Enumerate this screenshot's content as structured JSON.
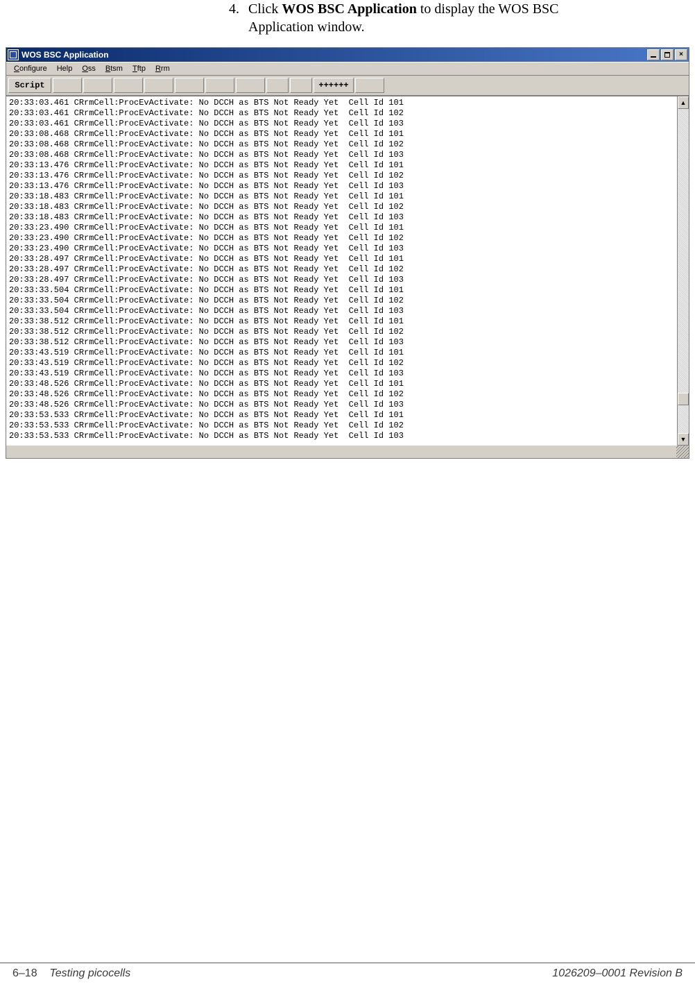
{
  "instruction": {
    "number": "4.",
    "text_before": "Click ",
    "bold": "WOS BSC Application",
    "text_after": " to display the WOS BSC Application window."
  },
  "window": {
    "title": "WOS BSC Application",
    "menu": {
      "configure_pre": "C",
      "configure_post": "onfigure",
      "help": "Help",
      "oss_pre": "O",
      "oss_post": "ss",
      "btsm_pre": "B",
      "btsm_post": "tsm",
      "tftp_pre": "T",
      "tftp_post": "ftp",
      "rrm_pre": "R",
      "rrm_post": "rm"
    },
    "toolbar": {
      "script": "Script",
      "plus": "++++++"
    }
  },
  "log_message": "CRrmCell:ProcEvActivate: No DCCH as BTS Not Ready Yet",
  "log_cell_prefix": "Cell Id",
  "log_rows": [
    {
      "time": "20:33:03.461",
      "cell": "101"
    },
    {
      "time": "20:33:03.461",
      "cell": "102"
    },
    {
      "time": "20:33:03.461",
      "cell": "103"
    },
    {
      "time": "20:33:08.468",
      "cell": "101"
    },
    {
      "time": "20:33:08.468",
      "cell": "102"
    },
    {
      "time": "20:33:08.468",
      "cell": "103"
    },
    {
      "time": "20:33:13.476",
      "cell": "101"
    },
    {
      "time": "20:33:13.476",
      "cell": "102"
    },
    {
      "time": "20:33:13.476",
      "cell": "103"
    },
    {
      "time": "20:33:18.483",
      "cell": "101"
    },
    {
      "time": "20:33:18.483",
      "cell": "102"
    },
    {
      "time": "20:33:18.483",
      "cell": "103"
    },
    {
      "time": "20:33:23.490",
      "cell": "101"
    },
    {
      "time": "20:33:23.490",
      "cell": "102"
    },
    {
      "time": "20:33:23.490",
      "cell": "103"
    },
    {
      "time": "20:33:28.497",
      "cell": "101"
    },
    {
      "time": "20:33:28.497",
      "cell": "102"
    },
    {
      "time": "20:33:28.497",
      "cell": "103"
    },
    {
      "time": "20:33:33.504",
      "cell": "101"
    },
    {
      "time": "20:33:33.504",
      "cell": "102"
    },
    {
      "time": "20:33:33.504",
      "cell": "103"
    },
    {
      "time": "20:33:38.512",
      "cell": "101"
    },
    {
      "time": "20:33:38.512",
      "cell": "102"
    },
    {
      "time": "20:33:38.512",
      "cell": "103"
    },
    {
      "time": "20:33:43.519",
      "cell": "101"
    },
    {
      "time": "20:33:43.519",
      "cell": "102"
    },
    {
      "time": "20:33:43.519",
      "cell": "103"
    },
    {
      "time": "20:33:48.526",
      "cell": "101"
    },
    {
      "time": "20:33:48.526",
      "cell": "102"
    },
    {
      "time": "20:33:48.526",
      "cell": "103"
    },
    {
      "time": "20:33:53.533",
      "cell": "101"
    },
    {
      "time": "20:33:53.533",
      "cell": "102"
    },
    {
      "time": "20:33:53.533",
      "cell": "103"
    }
  ],
  "footer": {
    "page_left_prefix": "6–18",
    "page_left_text": "Testing picocells",
    "doc_right_text": "1026209–0001  Revision B"
  }
}
